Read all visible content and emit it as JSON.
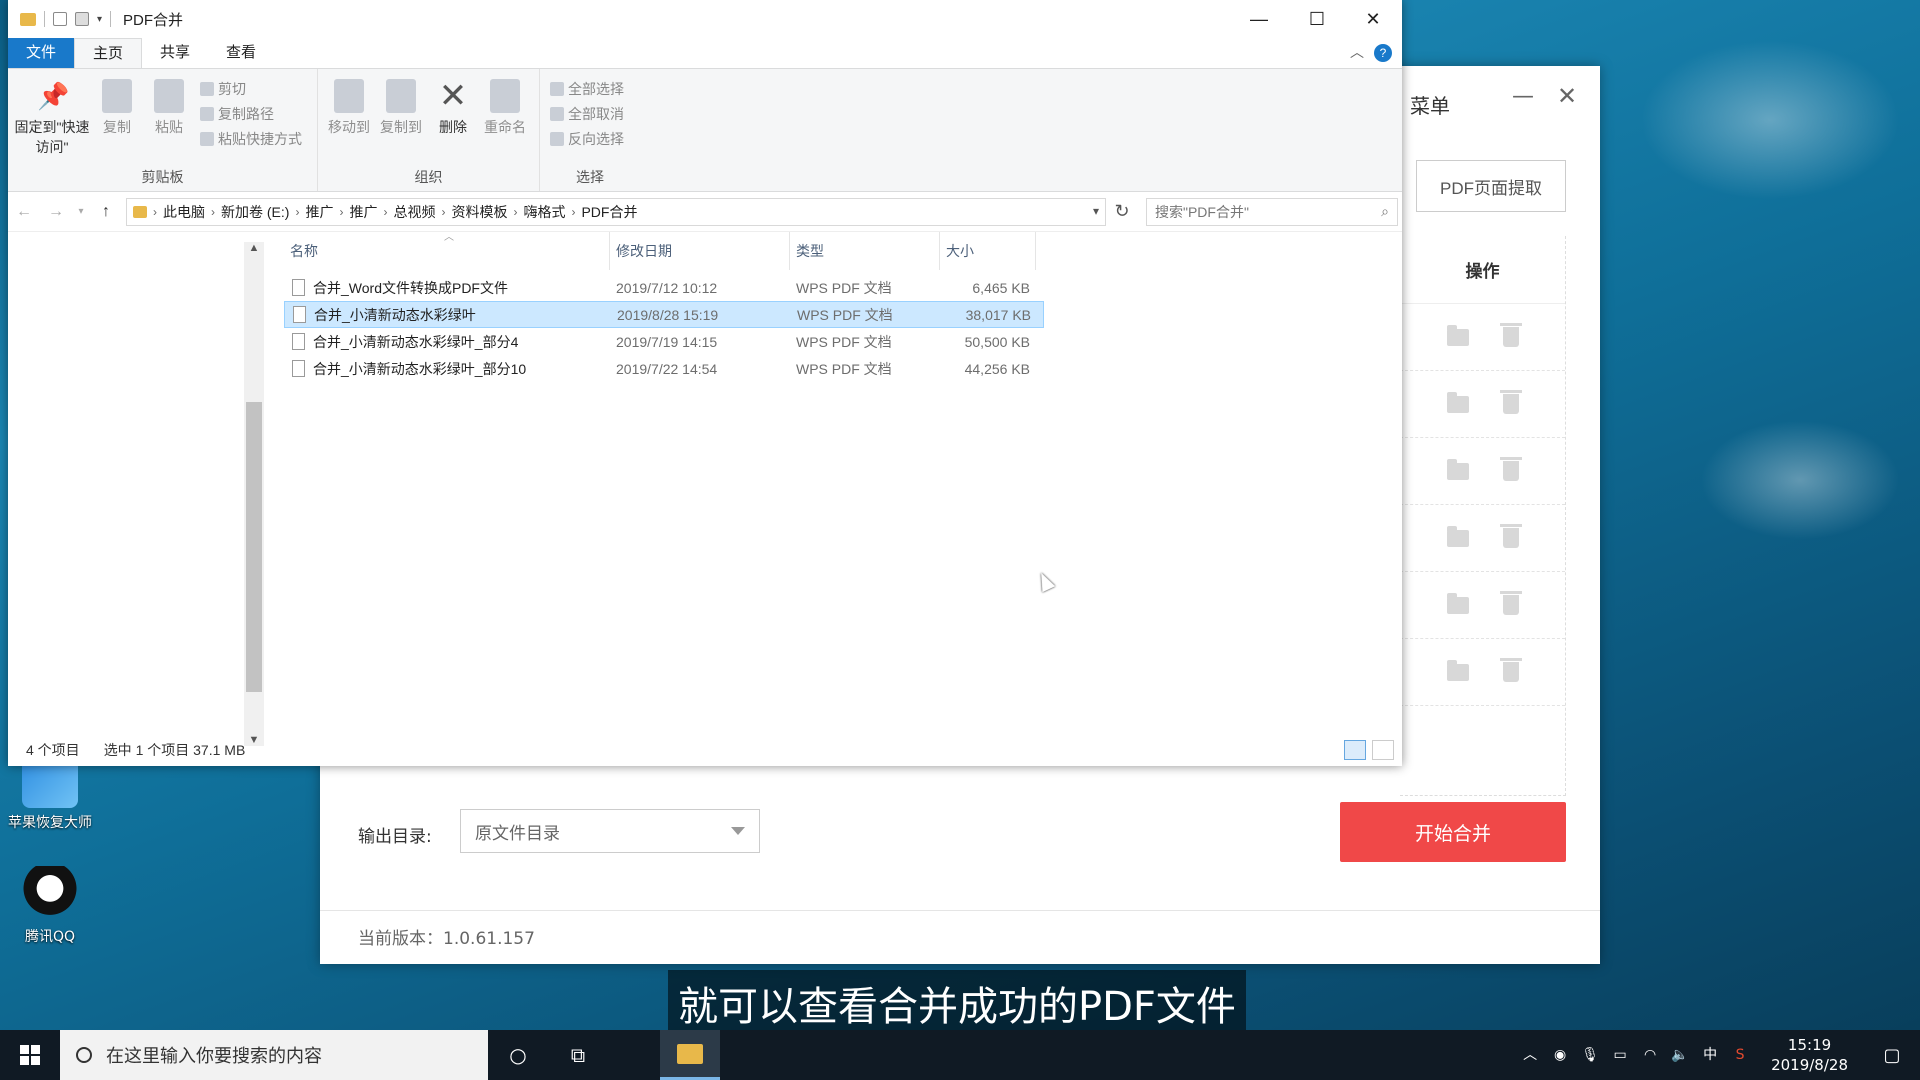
{
  "desktop": {
    "icons": [
      {
        "label": "苹果恢复大师"
      },
      {
        "label": "腾讯QQ"
      }
    ]
  },
  "pdftool": {
    "menu_title": "菜单",
    "extract_button": "PDF页面提取",
    "ops_header": "操作",
    "output_label": "输出目录:",
    "output_value": "原文件目录",
    "merge_button": "开始合并",
    "version": "当前版本：1.0.61.157"
  },
  "explorer": {
    "title": "PDF合并",
    "tabs": [
      "文件",
      "主页",
      "共享",
      "查看"
    ],
    "ribbon": {
      "clipboard": {
        "pin_label": "固定到\"快速访问\"",
        "copy": "复制",
        "paste": "粘贴",
        "cut": "剪切",
        "copy_path": "复制路径",
        "paste_shortcut": "粘贴快捷方式",
        "group": "剪贴板"
      },
      "organize": {
        "move_to": "移动到",
        "copy_to": "复制到",
        "delete": "删除",
        "rename": "重命名",
        "group": "组织"
      },
      "select": {
        "select_all": "全部选择",
        "select_none": "全部取消",
        "invert": "反向选择",
        "group": "选择"
      }
    },
    "breadcrumb": [
      "此电脑",
      "新加卷 (E:)",
      "推广",
      "推广",
      "总视频",
      "资料模板",
      "嗨格式",
      "PDF合并"
    ],
    "search_placeholder": "搜索\"PDF合并\"",
    "columns": {
      "name": "名称",
      "date": "修改日期",
      "type": "类型",
      "size": "大小"
    },
    "files": [
      {
        "name": "合并_Word文件转换成PDF文件",
        "date": "2019/7/12 10:12",
        "type": "WPS PDF 文档",
        "size": "6,465 KB",
        "selected": false
      },
      {
        "name": "合并_小清新动态水彩绿叶",
        "date": "2019/8/28 15:19",
        "type": "WPS PDF 文档",
        "size": "38,017 KB",
        "selected": true
      },
      {
        "name": "合并_小清新动态水彩绿叶_部分4",
        "date": "2019/7/19 14:15",
        "type": "WPS PDF 文档",
        "size": "50,500 KB",
        "selected": false
      },
      {
        "name": "合并_小清新动态水彩绿叶_部分10",
        "date": "2019/7/22 14:54",
        "type": "WPS PDF 文档",
        "size": "44,256 KB",
        "selected": false
      }
    ],
    "status": {
      "count": "4 个项目",
      "selection": "选中 1 个项目  37.1 MB"
    }
  },
  "subtitle": "就可以查看合并成功的PDF文件",
  "taskbar": {
    "search_placeholder": "在这里输入你要搜索的内容",
    "ime": "中",
    "time": "15:19",
    "date": "2019/8/28"
  },
  "colors": {
    "accent": "#1979ca",
    "merge_button": "#f04848",
    "selection": "#cce8ff"
  }
}
